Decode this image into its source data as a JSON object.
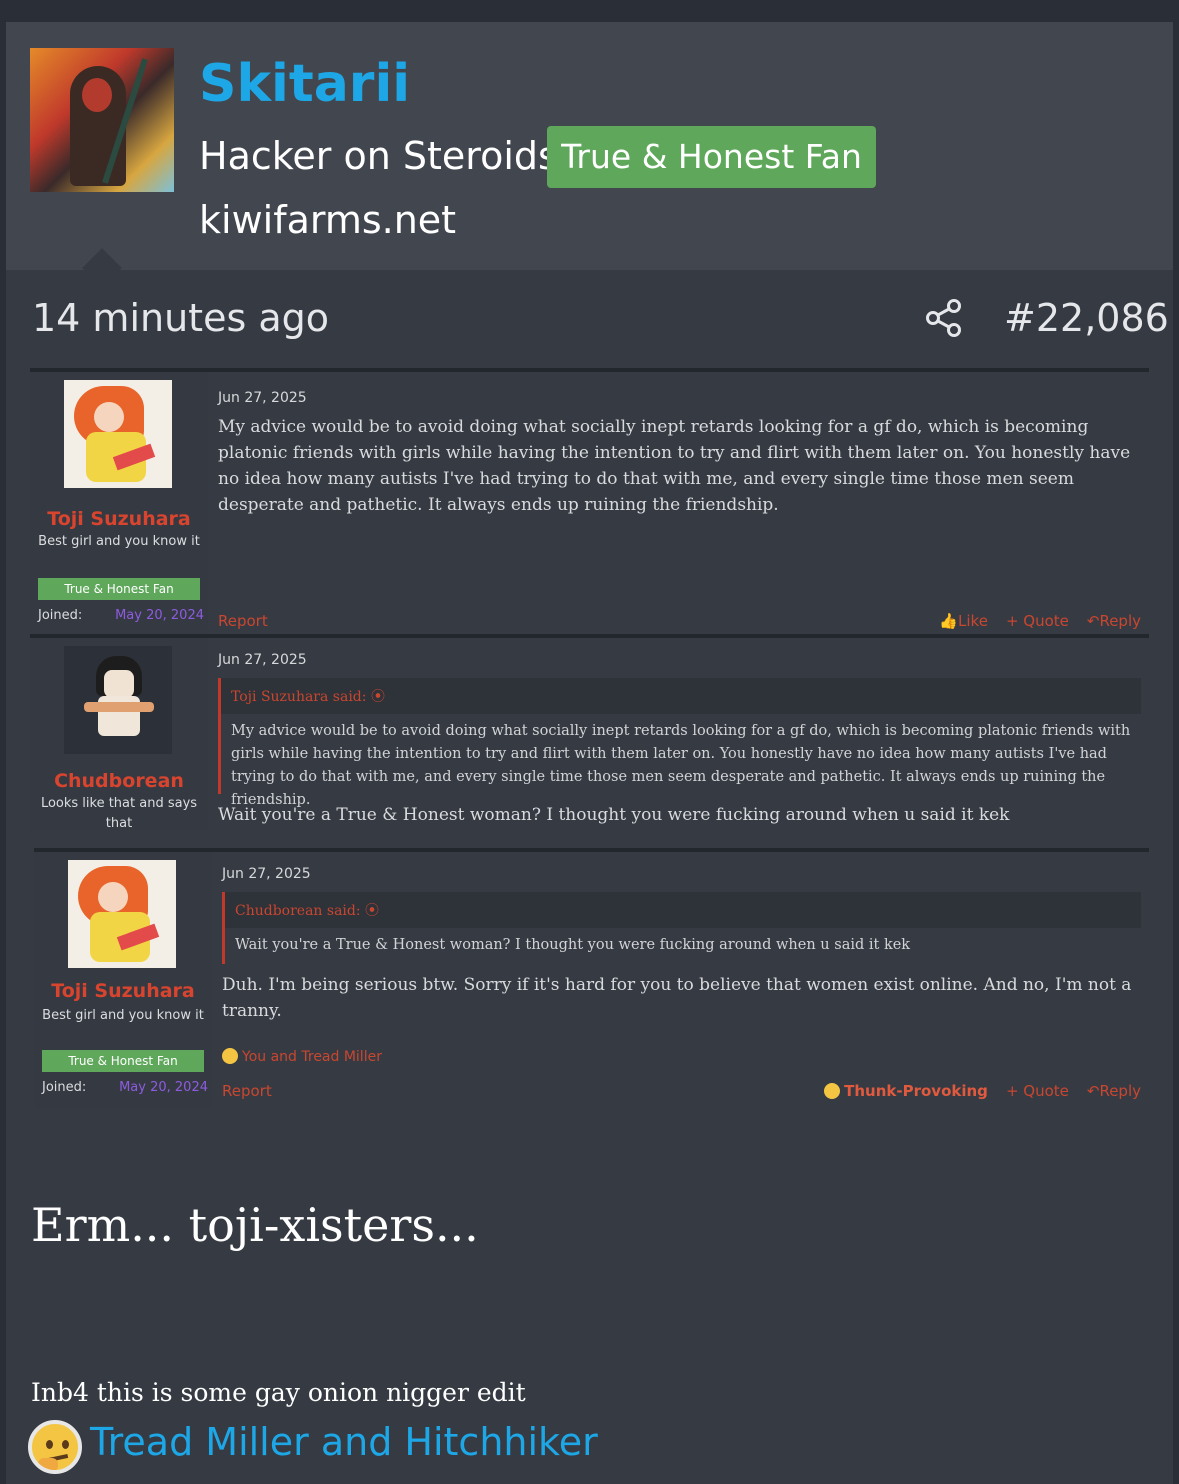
{
  "post": {
    "author": "Skitarii",
    "user_title": "Hacker on Steroids",
    "badge": "True & Honest Fan",
    "site": "kiwifarms.net",
    "time_ago": "14 minutes ago",
    "post_number": "#22,086",
    "body_big": "Erm... toji-xisters...",
    "body_small": "Inb4 this is some gay onion nigger edit",
    "reactions": "Tread Miller and Hitchhiker"
  },
  "embedded": [
    {
      "name": "Toji Suzuhara",
      "title": "Best girl and you know it",
      "badge": "True & Honest Fan",
      "joined_label": "Joined:",
      "joined_date": "May 20, 2024",
      "date": "Jun 27, 2025",
      "text": "My advice would be to avoid doing what socially inept retards looking for a gf do, which is becoming platonic friends with girls while having the intention to try and flirt with them later on. You honestly have no idea how many autists I've had trying to do that with me, and every single time those men seem desperate and pathetic. It always ends up ruining the friendship.",
      "report": "Report",
      "like": "Like",
      "quote": "+ Quote",
      "reply": "Reply"
    },
    {
      "name": "Chudborean",
      "title": "Looks like that and says that",
      "date": "Jun 27, 2025",
      "quote_head": "Toji Suzuhara said: ⦿",
      "quote_body": "My advice would be to avoid doing what socially inept retards looking for a gf do, which is becoming platonic friends with girls while having the intention to try and flirt with them later on. You honestly have no idea how many autists I've had trying to do that with me, and every single time those men seem desperate and pathetic. It always ends up ruining the friendship.",
      "text": "Wait you're a True & Honest woman? I thought you were fucking around when u said it kek"
    },
    {
      "name": "Toji Suzuhara",
      "title": "Best girl and you know it",
      "badge": "True & Honest Fan",
      "joined_label": "Joined:",
      "joined_date": "May 20, 2024",
      "date": "Jun 27, 2025",
      "quote_head": "Chudborean said: ⦿",
      "quote_body": "Wait you're a True & Honest woman? I thought you were fucking around when u said it kek",
      "text": "Duh. I'm being serious btw. Sorry if it's hard for you to believe that women exist online. And no, I'm not a tranny.",
      "reactions": "You and Tread Miller",
      "report": "Report",
      "thunk": "Thunk-Provoking",
      "quote": "+ Quote",
      "reply": "Reply"
    }
  ],
  "colors": {
    "username": "#1ea7e6",
    "badge": "#5fa85b",
    "accent_red": "#c9462f",
    "joined_date": "#8e5be0"
  },
  "icons": [
    "share-icon",
    "thumbs-up-icon",
    "reply-icon",
    "thinking-emoji-icon"
  ]
}
